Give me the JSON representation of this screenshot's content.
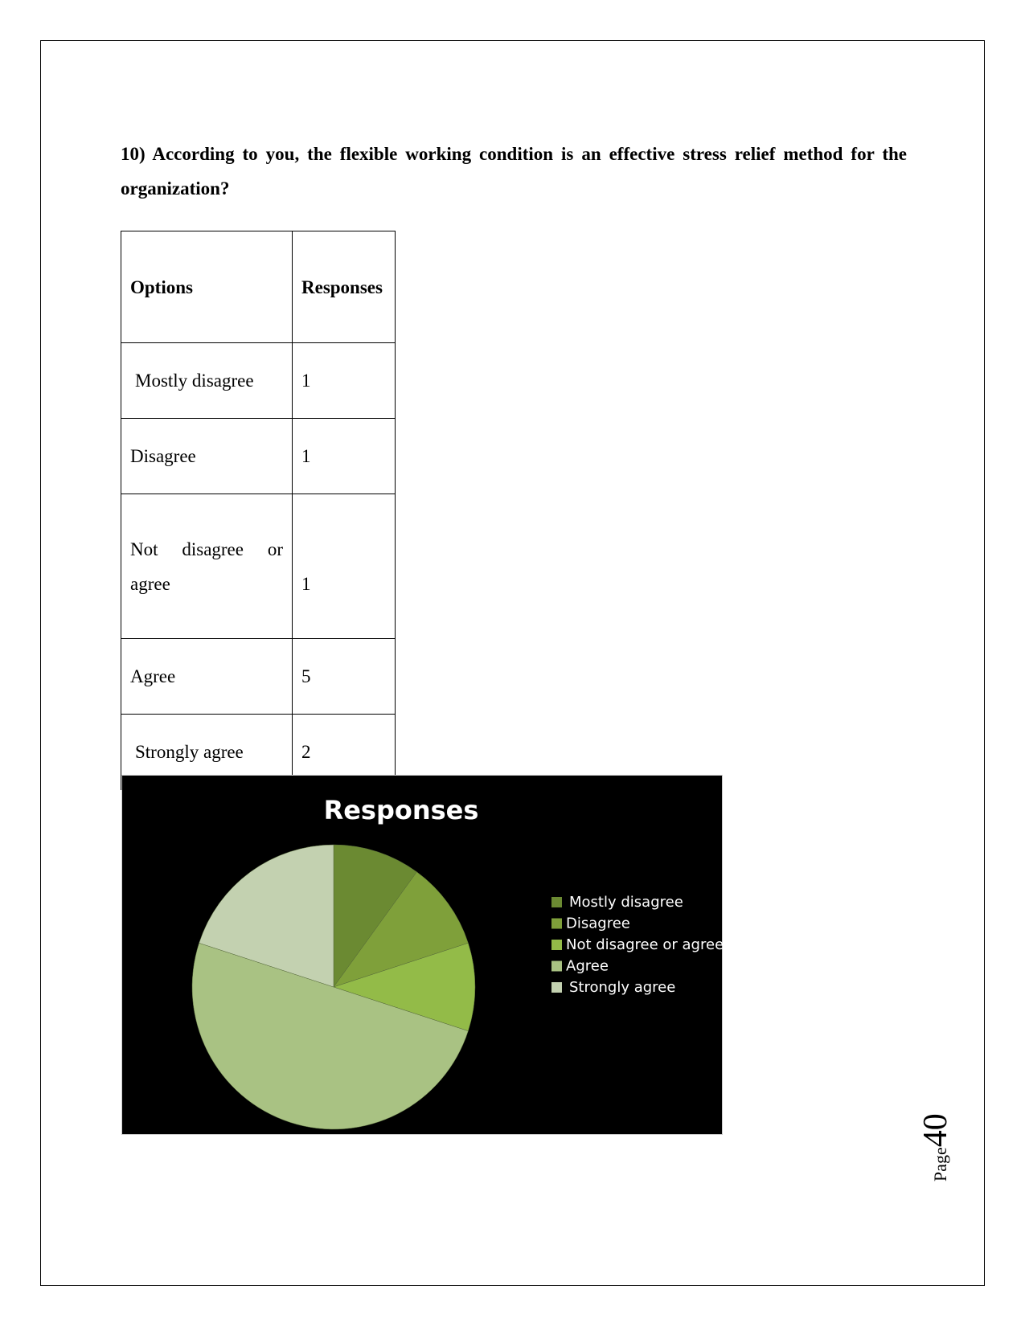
{
  "question": "10) According to you, the flexible working condition is an effective stress relief method for the organization?",
  "table": {
    "headers": [
      "Options",
      "Responses"
    ],
    "rows": [
      {
        "option": "Mostly disagree",
        "responses": "1"
      },
      {
        "option": "Disagree",
        "responses": "1"
      },
      {
        "option": "Not disagree or agree",
        "responses": "1"
      },
      {
        "option": "Agree",
        "responses": "5"
      },
      {
        "option": "Strongly agree",
        "responses": "2"
      }
    ]
  },
  "chart_data": {
    "type": "pie",
    "title": "Responses",
    "categories": [
      "Mostly disagree",
      "Disagree",
      "Not disagree or agree",
      "Agree",
      "Strongly agree"
    ],
    "values": [
      1,
      1,
      1,
      5,
      2
    ],
    "colors": [
      "#6b8a32",
      "#7fa03a",
      "#93bb48",
      "#a9c283",
      "#c3d1b0"
    ],
    "background": "#000000",
    "legend_position": "right"
  },
  "footer": {
    "page_label": "Page",
    "page_number": "40"
  }
}
